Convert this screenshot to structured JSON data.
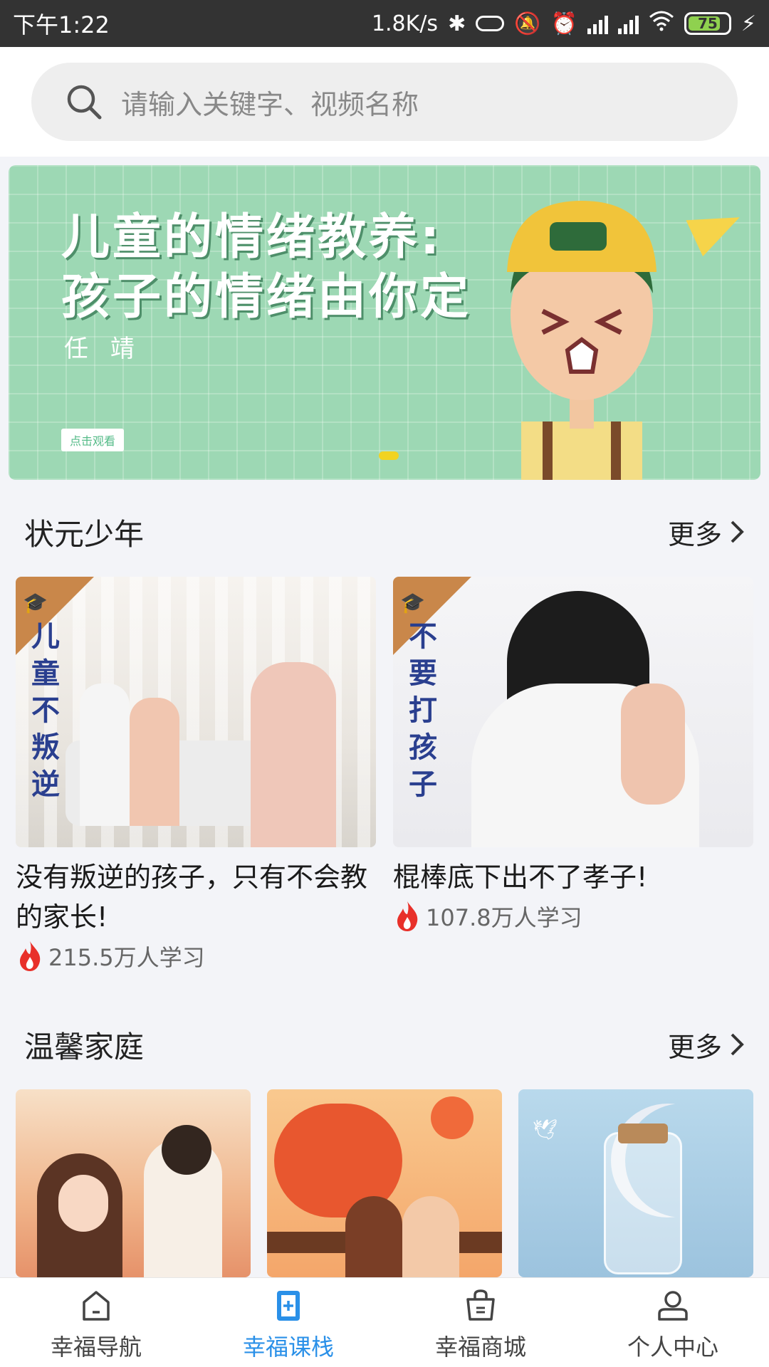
{
  "status_bar": {
    "time": "下午1:22",
    "network_speed": "1.8K/s",
    "battery_level": "75",
    "icons": [
      "bluetooth-icon",
      "vibrate-icon",
      "mute-icon",
      "alarm-icon",
      "signal-icon",
      "hd-signal-icon",
      "wifi-icon",
      "battery-icon",
      "charging-icon"
    ]
  },
  "search": {
    "placeholder": "请输入关键字、视频名称",
    "icon": "search-icon"
  },
  "banner": {
    "title_line1": "儿童的情绪教养:",
    "title_line2": "孩子的情绪由你定",
    "author": "任 靖",
    "watch_label": "点击观看"
  },
  "sections": [
    {
      "title": "状元少年",
      "more_label": "更多",
      "items": [
        {
          "thumb_text": "儿童不叛逆",
          "title": "没有叛逆的孩子，只有不会教的家长!",
          "learners": "215.5万人学习"
        },
        {
          "thumb_text": "不要打孩子",
          "title": "棍棒底下出不了孝子!",
          "learners": "107.8万人学习"
        }
      ]
    },
    {
      "title": "温馨家庭",
      "more_label": "更多"
    }
  ],
  "bottom_nav": {
    "items": [
      {
        "label": "幸福导航",
        "icon": "home-icon",
        "active": false
      },
      {
        "label": "幸福课栈",
        "icon": "course-book-icon",
        "active": true
      },
      {
        "label": "幸福商城",
        "icon": "shopping-bag-icon",
        "active": false
      },
      {
        "label": "个人中心",
        "icon": "user-icon",
        "active": false
      }
    ]
  },
  "colors": {
    "status_bar_bg": "#333333",
    "page_bg": "#f3f4f8",
    "accent": "#2a90e8",
    "banner_bg": "#9dd8b4",
    "flame": "#e8302a"
  }
}
